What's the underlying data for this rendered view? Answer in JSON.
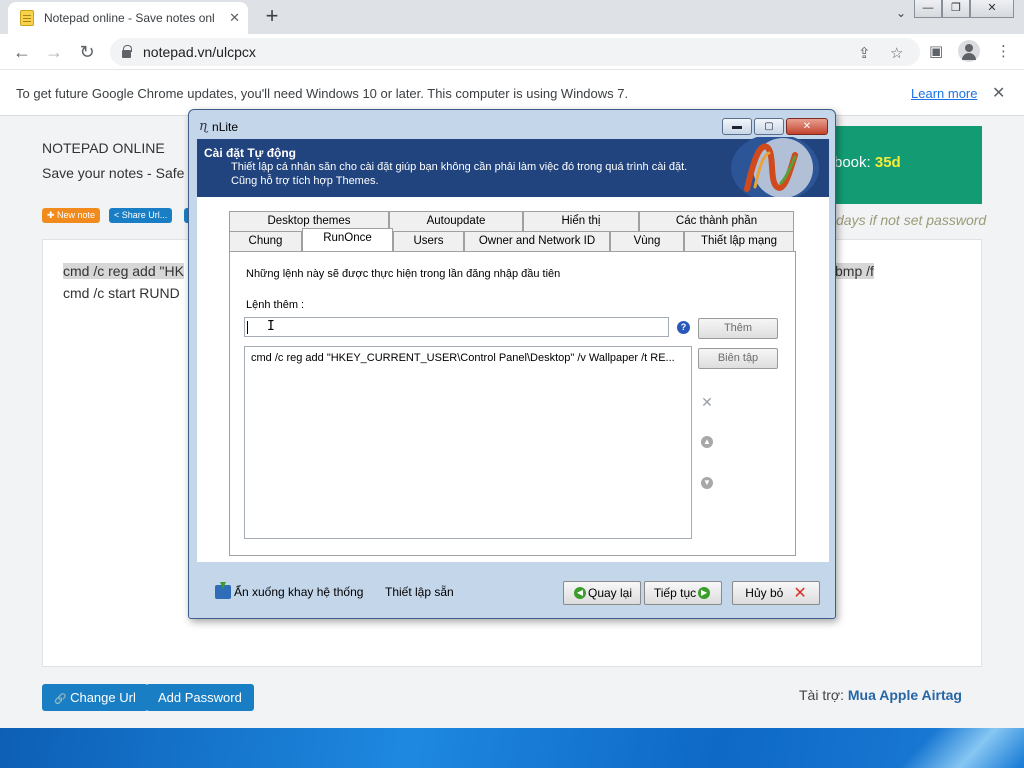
{
  "browser": {
    "tab_title": "Notepad online - Save notes onl",
    "tab_close": "✕",
    "new_tab": "+",
    "tab_search": "⌄",
    "url": "notepad.vn/ulcpcx",
    "window_buttons": {
      "minimize": "—",
      "maximize": "❐",
      "close": "✕"
    },
    "nav": {
      "back": "←",
      "forward": "→",
      "reload": "↻"
    },
    "share": "⇪",
    "bookmark": "☆",
    "sidepanel": "▣",
    "menu": "⋮"
  },
  "infobar": {
    "message": "To get future Google Chrome updates, you'll need Windows 10 or later. This computer is using Windows 7.",
    "learn_more": "Learn more",
    "close": "✕"
  },
  "page": {
    "title": "NOTEPAD ONLINE",
    "subtitle": "Save your notes - Safe",
    "new_note": "✚ New note",
    "share_url": "< Share Url...",
    "ad_text": "book:",
    "ad_days": "35d",
    "password_hint": "days if not set password",
    "editor_line1_start": "cmd /c reg add \"HK",
    "editor_line1_end": "bmp /f",
    "editor_line2": "cmd /c start RUND",
    "change_url": "Change Url",
    "change_url_icon": "🔗",
    "add_password": "Add Password",
    "sponsor_label": "Tài trợ:",
    "sponsor_link": "Mua Apple Airtag"
  },
  "dialog": {
    "title": "nLite",
    "caption": {
      "minimize": "▬",
      "maximize": "▢",
      "close": "✕"
    },
    "banner_heading": "Cài đặt Tự động",
    "banner_line1": "Thiết lập cá nhân săn cho cài đặt giúp bạn không cần phải làm việc đó trong quá trình cài đặt.",
    "banner_line2": "Cũng hỗ trợ tích hợp Themes.",
    "tabs_row1": [
      "Desktop themes",
      "Autoupdate",
      "Hiển thị",
      "Các thành phần"
    ],
    "tabs_row2": [
      "Chung",
      "RunOnce",
      "Users",
      "Owner and Network ID",
      "Vùng",
      "Thiết lập mạng"
    ],
    "panel_info": "Những lệnh này sẽ được thực hiện trong lần đăng nhập đầu tiên",
    "add_label": "Lệnh thêm :",
    "input_value": "",
    "help": "?",
    "add_button": "Thêm",
    "edit_button": "Biên tập",
    "list_items": [
      "cmd /c reg add \"HKEY_CURRENT_USER\\Control Panel\\Desktop\" /v Wallpaper /t RE..."
    ],
    "delete_icon": "✕",
    "up_icon": "▲",
    "down_icon": "▼",
    "minimize_tray": "Ẩn xuống khay hệ thống",
    "presets": "Thiết lập sẵn",
    "back": "Quay lại",
    "next": "Tiếp tục",
    "cancel": "Hủy bỏ",
    "cancel_icon": "✕",
    "back_icon": "◀",
    "next_icon": "▶"
  }
}
